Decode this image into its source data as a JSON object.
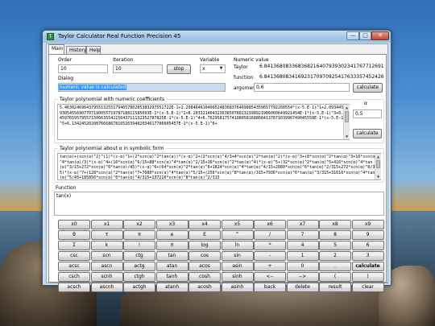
{
  "window": {
    "title": "Taylor Calculator Real Function Precision 45",
    "icon_name": "calculator-app-icon",
    "min_glyph": "—",
    "max_glyph": "□",
    "close_glyph": "✕"
  },
  "tabs": [
    {
      "label": "Main"
    },
    {
      "label": "History"
    },
    {
      "label": "Help"
    }
  ],
  "controls": {
    "order_label": "Order",
    "order_value": "10",
    "iteration_label": "Iteration",
    "iteration_value": "10",
    "stop_label": "stop",
    "variable_label": "Variable",
    "variable_value": "x",
    "dialog_label": "Dialog",
    "dialog_value": "numeric value is calculated"
  },
  "numeric": {
    "header": "Numeric value",
    "taylor_label": "Taylor",
    "taylor_value": "6.84136808336836821640793930234176771269187645E-1",
    "function_label": "function",
    "function_value": "6.84136808341692317097092541763335745242654081E-1",
    "argument_label": "argument",
    "argument_value": "0.6",
    "calculate_label": "calculate"
  },
  "taylor_numeric": {
    "title": "Taylor polynomial with numeric coefficients",
    "text": "5.46302469643795513255179465780285383297551722E-1+1.29846461040952483683764698854359657792268554*(x-5.E-1)^1+2.09344569305455690770719005571978718811585093E-1*(x-5.E-1)^2+8.20332140432363650780232398921986060649921454E-1*(x-5.E-1)^3+6.84597659579557150663554215643711132352787825E-1*(x-5.E-1)^4+6.76295817574108058168868413787103996749045558E-1*(x-5.E-1)^5+6.13424520208766686781052639482034617706605457E-1*(x-5.E-1)^6+",
    "alpha_label": "α",
    "alpha_value": "0.5",
    "calculate_label": "calculate"
  },
  "taylor_symbolic": {
    "title": "Taylor polynomial about α in symbolic form",
    "text": "tan(α)+(scn(α)^2)^(1)*(x-α)^1+(2*scn(α)^2*tan(α))*(x-α)^2+(2*scn(α)^4/3+4*scn(α)^2*tan(α)^2)*(x-α)^3+(8*scn(α)^2*tan(α)^3+16*scn(α)^4*tan(α)/3)*(x-α)^4+(16*scn(α)^6/15+88*scn(α)^4*tan(α)^2/15+16*scn(α)^2*tan(α)^4)*(x-α)^5+(32*scn(α)^2*tan(α)^5+416*scn(α)^4*tan(α)^3/15+272*scn(α)^6*tan(α)/45)*(x-α)^6+(64*scn(α)^2*tan(α)^6+1824*scn(α)^4*tan(α)^4/15+2880*scn(α)^6*tan(α)^2/315+272*scn(α)^8/315)*(x-α)^7+(128*scn(α)^2*tan(α)^7+7680*scn(α)^4*tan(α)^5/15+(256*scn(α)^8*tan(α)/315+7936*scn(α)^6*tan(α)^3/315+31616*scn(α)^4*tan(α)^5/45+185856*scn(α)^6*tan(α)^4/315+137216*scn(α)^8*tan(α)^2/315"
  },
  "function": {
    "header": "Function",
    "value": "tan(x)"
  },
  "keypad": [
    [
      "x0",
      "x1",
      "x2",
      "x3",
      "x4",
      "x5",
      "x6",
      "x7",
      "x8",
      "x9"
    ],
    [
      "θ",
      "τ",
      "π",
      "e",
      "E",
      "^",
      "/",
      "7",
      "8",
      "9"
    ],
    [
      "Σ",
      "k",
      "!",
      "π",
      "log",
      "ln",
      "*",
      "4",
      "5",
      "6"
    ],
    [
      "csc",
      "scn",
      "ctg",
      "tan",
      "cos",
      "sin",
      "-",
      "1",
      "2",
      "3"
    ],
    [
      "acsc",
      "ascn",
      "actg",
      "atan",
      "acos",
      "asin",
      "+",
      "0",
      ".",
      "calculate"
    ],
    [
      "csch",
      "scnh",
      "ctgh",
      "tanh",
      "cosh",
      "sinh",
      "<--",
      "-->",
      "(",
      ")"
    ],
    [
      "acsch",
      "ascnh",
      "actgh",
      "atanh",
      "acosh",
      "asinh",
      "back",
      "delete",
      "result",
      "clear"
    ]
  ]
}
